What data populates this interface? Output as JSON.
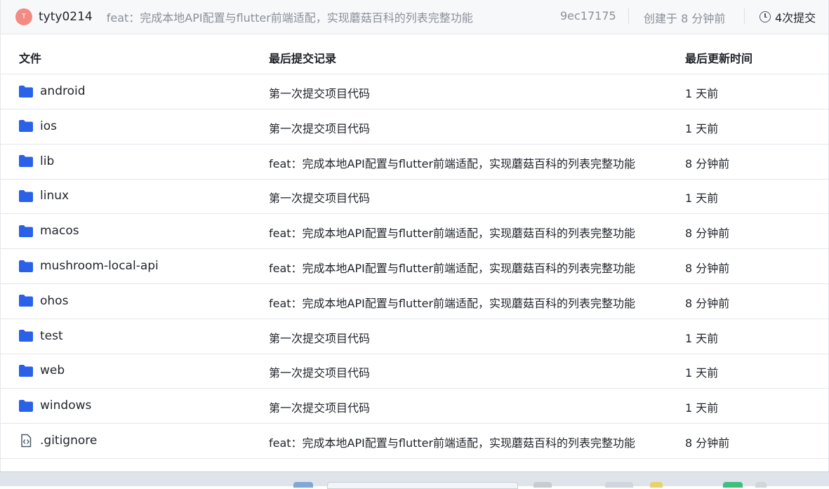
{
  "commit_bar": {
    "avatar_initial": "T",
    "author": "tyty0214",
    "message": "feat：完成本地API配置与flutter前端适配，实现蘑菇百科的列表完整功能",
    "hash": "9ec17175",
    "created": "创建于 8 分钟前",
    "commits": "4次提交"
  },
  "table": {
    "headers": [
      "文件",
      "最后提交记录",
      "最后更新时间"
    ],
    "rows": [
      {
        "name": "android",
        "type": "folder",
        "message": "第一次提交项目代码",
        "time": "1 天前"
      },
      {
        "name": "ios",
        "type": "folder",
        "message": "第一次提交项目代码",
        "time": "1 天前"
      },
      {
        "name": "lib",
        "type": "folder",
        "message": "feat：完成本地API配置与flutter前端适配，实现蘑菇百科的列表完整功能",
        "time": "8 分钟前"
      },
      {
        "name": "linux",
        "type": "folder",
        "message": "第一次提交项目代码",
        "time": "1 天前"
      },
      {
        "name": "macos",
        "type": "folder",
        "message": "feat：完成本地API配置与flutter前端适配，实现蘑菇百科的列表完整功能",
        "time": "8 分钟前"
      },
      {
        "name": "mushroom-local-api",
        "type": "folder",
        "message": "feat：完成本地API配置与flutter前端适配，实现蘑菇百科的列表完整功能",
        "time": "8 分钟前"
      },
      {
        "name": "ohos",
        "type": "folder",
        "message": "feat：完成本地API配置与flutter前端适配，实现蘑菇百科的列表完整功能",
        "time": "8 分钟前"
      },
      {
        "name": "test",
        "type": "folder",
        "message": "第一次提交项目代码",
        "time": "1 天前"
      },
      {
        "name": "web",
        "type": "folder",
        "message": "第一次提交项目代码",
        "time": "1 天前"
      },
      {
        "name": "windows",
        "type": "folder",
        "message": "第一次提交项目代码",
        "time": "1 天前"
      },
      {
        "name": ".gitignore",
        "type": "file",
        "message": "feat：完成本地API配置与flutter前端适配，实现蘑菇百科的列表完整功能",
        "time": "8 分钟前"
      }
    ]
  },
  "colors": {
    "folder": "#2962e8",
    "avatar": "#f28b82",
    "muted_text": "#8a8f99"
  }
}
